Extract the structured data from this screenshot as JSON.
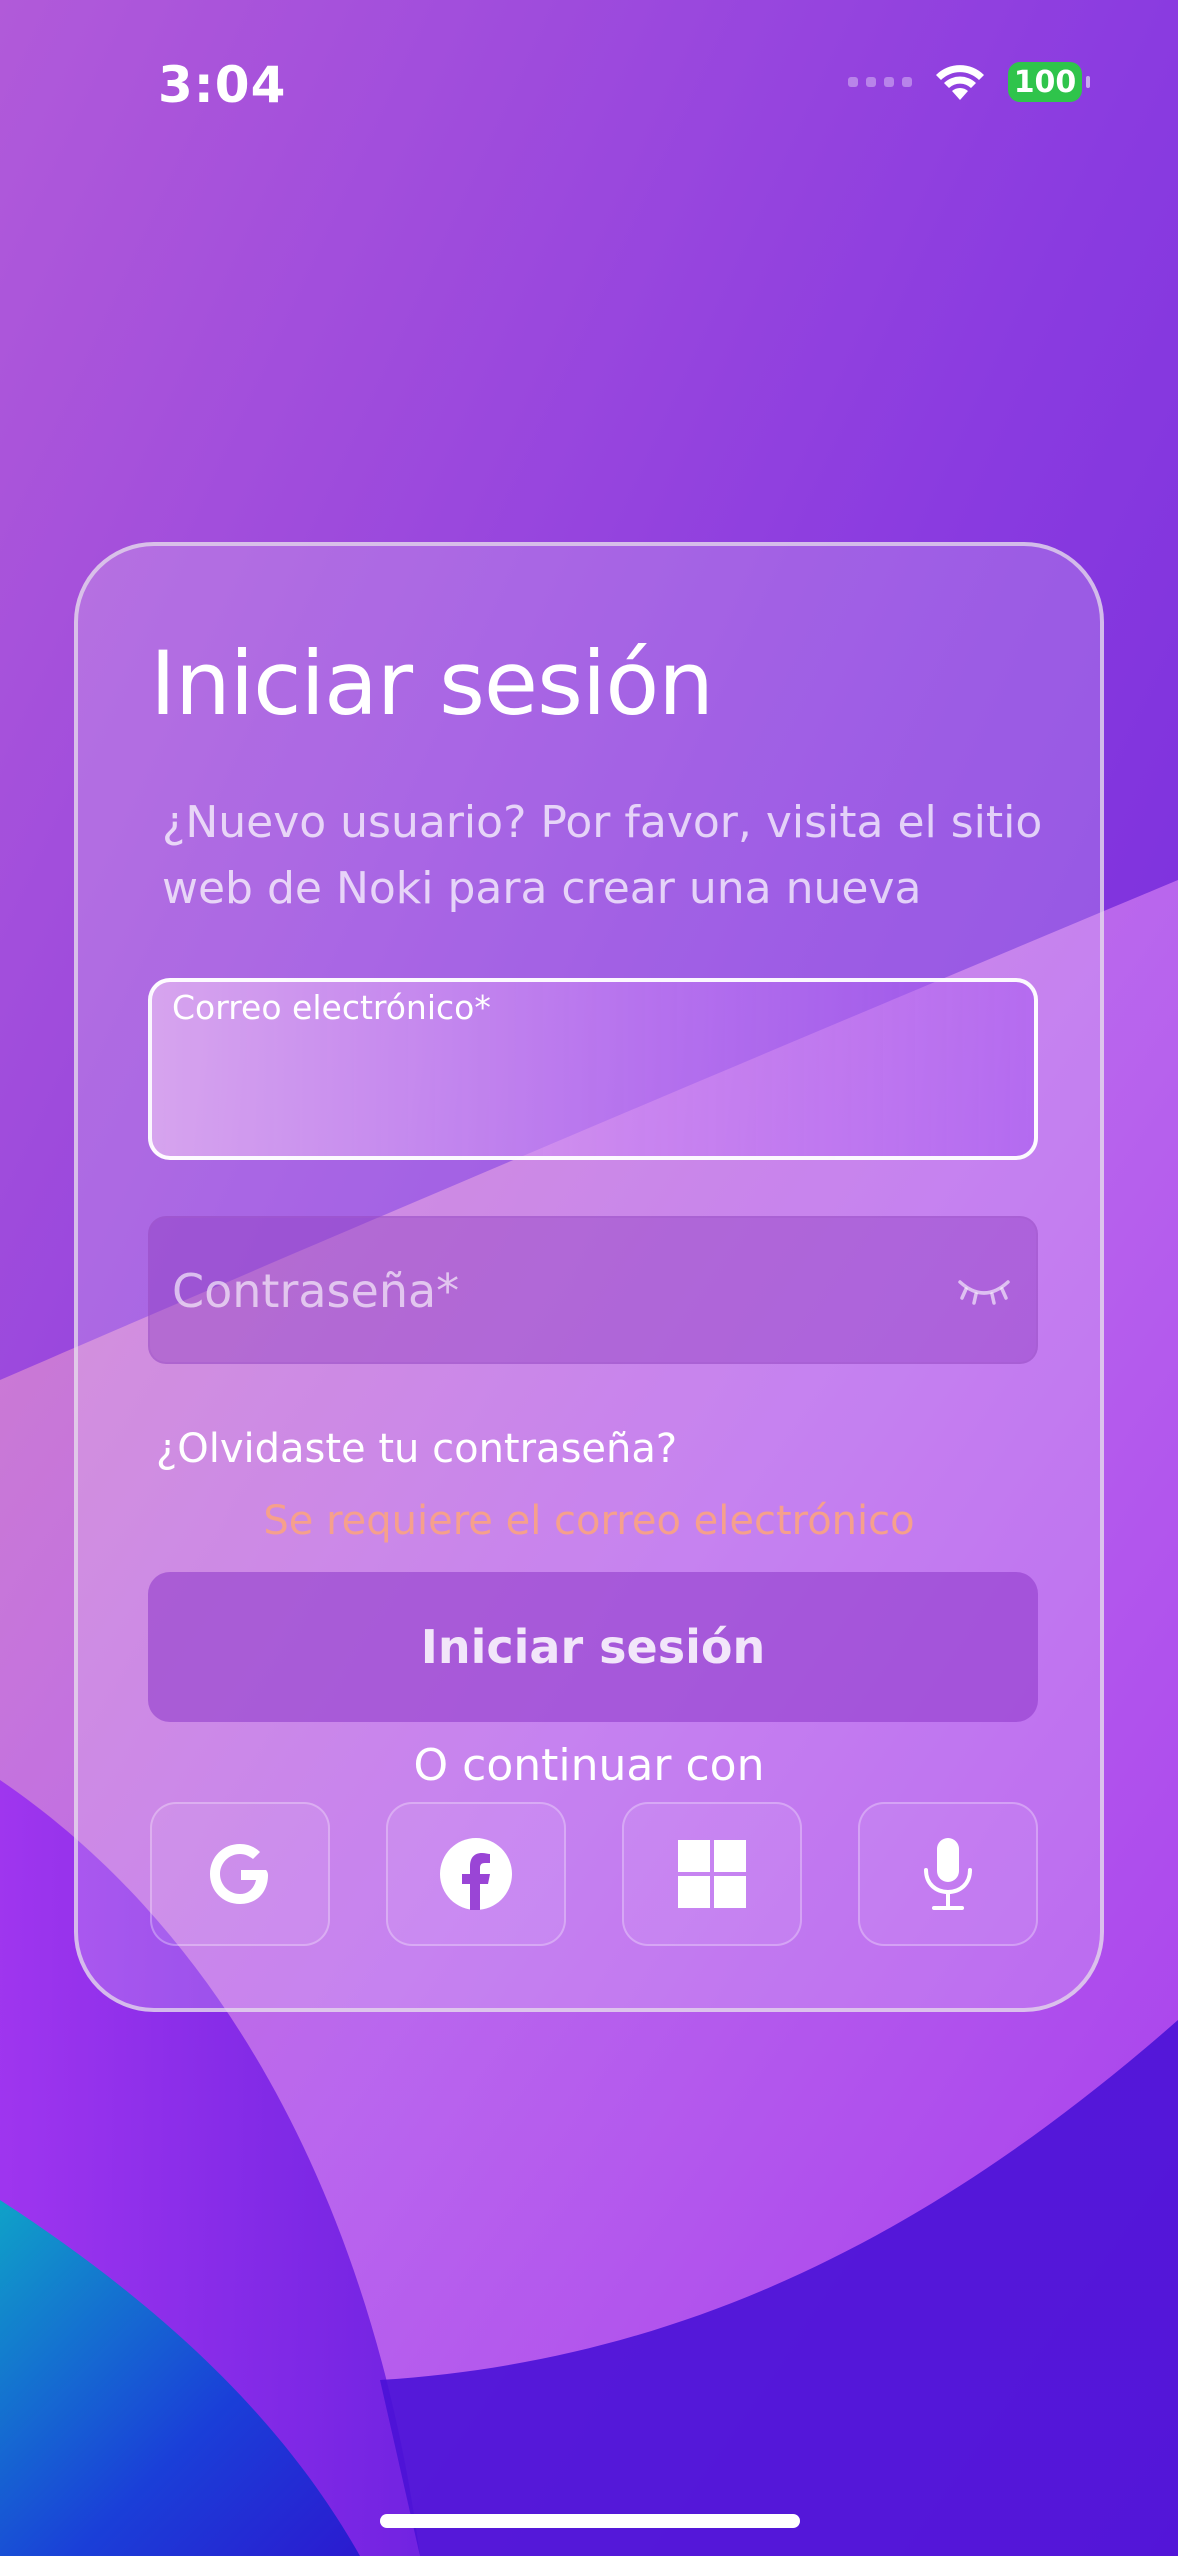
{
  "status_bar": {
    "time": "3:04",
    "battery_level": "100"
  },
  "login": {
    "title": "Iniciar sesión",
    "subtitle": "¿Nuevo usuario? Por favor, visita el sitio web de Noki para crear una nueva",
    "email_label": "Correo electrónico*",
    "email_value": "",
    "password_placeholder": "Contraseña*",
    "forgot_password": "¿Olvidaste tu contraseña?",
    "error_message": "Se requiere el correo electrónico",
    "submit_label": "Iniciar sesión",
    "continue_with": "O continuar con"
  },
  "social_providers": [
    {
      "icon": "google-icon"
    },
    {
      "icon": "facebook-icon"
    },
    {
      "icon": "windows-icon"
    },
    {
      "icon": "microphone-icon"
    }
  ],
  "colors": {
    "error": "#f6a08c",
    "battery": "#2fc44b"
  }
}
